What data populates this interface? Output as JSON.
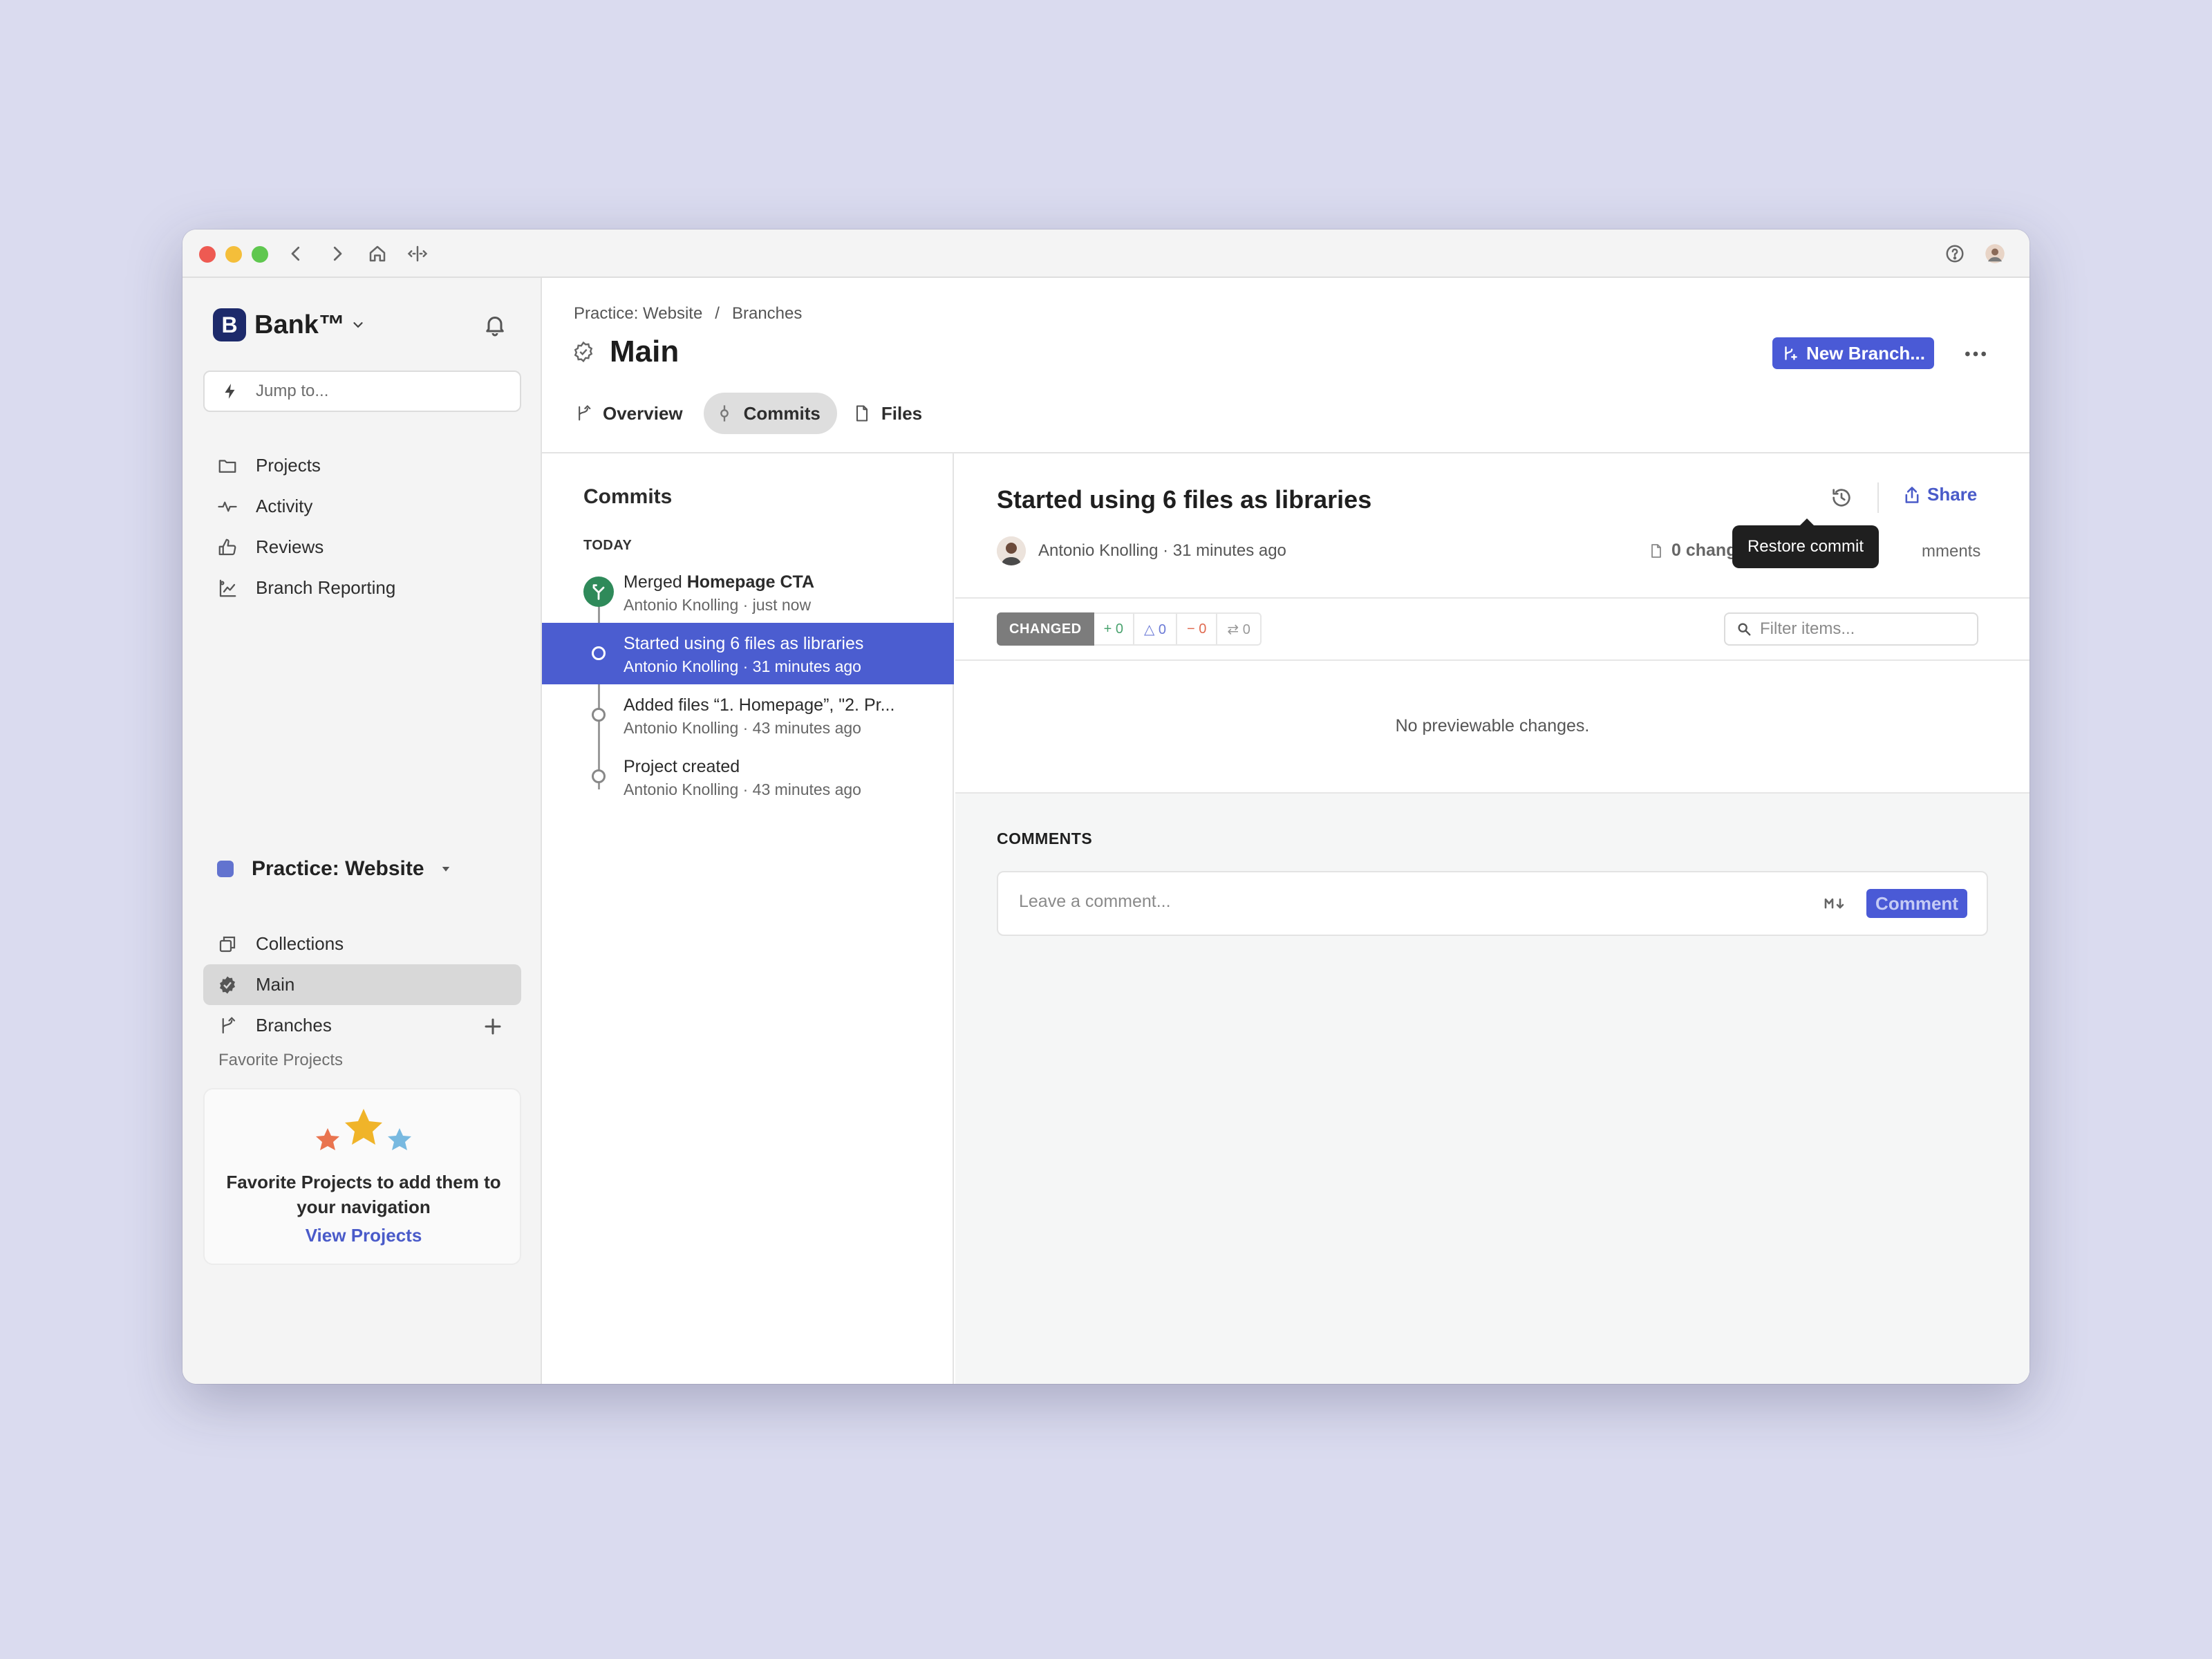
{
  "window": {
    "help_icon": "question-circle-icon",
    "avatar_icon": "user-avatar"
  },
  "sidebar": {
    "workspace_name": "Bank™",
    "workspace_logo_letter": "B",
    "jump_placeholder": "Jump to...",
    "nav_items": [
      {
        "label": "Projects",
        "icon": "folder-icon"
      },
      {
        "label": "Activity",
        "icon": "activity-icon"
      },
      {
        "label": "Reviews",
        "icon": "thumbs-up-icon"
      },
      {
        "label": "Branch Reporting",
        "icon": "branch-chart-icon"
      }
    ],
    "project": {
      "name": "Practice: Website",
      "color": "#6273cf",
      "items": [
        {
          "label": "Collections",
          "icon": "collections-icon"
        },
        {
          "label": "Main",
          "icon": "main-branch-icon"
        },
        {
          "label": "Branches",
          "icon": "branch-icon"
        }
      ]
    },
    "favorites": {
      "title": "Favorite Projects",
      "card_text": "Favorite Projects to add them to your navigation",
      "link": "View Projects"
    }
  },
  "header": {
    "breadcrumb": [
      "Practice: Website",
      "Branches"
    ],
    "breadcrumb_sep": "/",
    "title": "Main",
    "new_branch_label": "New Branch...",
    "tabs": [
      {
        "label": "Overview",
        "icon": "branch-icon"
      },
      {
        "label": "Commits",
        "icon": "commit-icon"
      },
      {
        "label": "Files",
        "icon": "file-icon"
      }
    ]
  },
  "commits": {
    "title": "Commits",
    "group": "TODAY",
    "items": [
      {
        "title_prefix": "Merged ",
        "title_bold": "Homepage CTA",
        "meta": "Antonio Knolling · just now",
        "type": "merge"
      },
      {
        "title": "Started using 6 files as libraries",
        "meta": "Antonio Knolling · 31 minutes ago",
        "selected": true
      },
      {
        "title": "Added files “1. Homepage”, \"2. Pr...",
        "meta": "Antonio Knolling · 43 minutes ago"
      },
      {
        "title": "Project created",
        "meta": "Antonio Knolling · 43 minutes ago"
      }
    ]
  },
  "detail": {
    "title": "Started using 6 files as libraries",
    "share_label": "Share",
    "tooltip": "Restore commit",
    "author": "Antonio Knolling · 31 minutes ago",
    "changed_files": "0 changed fi",
    "comments_count": "mments",
    "filter": {
      "badge": "CHANGED",
      "added": "+ 0",
      "modified": "△ 0",
      "removed": "− 0",
      "renamed": "⇄ 0",
      "placeholder": "Filter items..."
    },
    "empty_message": "No previewable changes.",
    "comments_title": "COMMENTS",
    "comment_placeholder": "Leave a comment...",
    "comment_button": "Comment"
  }
}
